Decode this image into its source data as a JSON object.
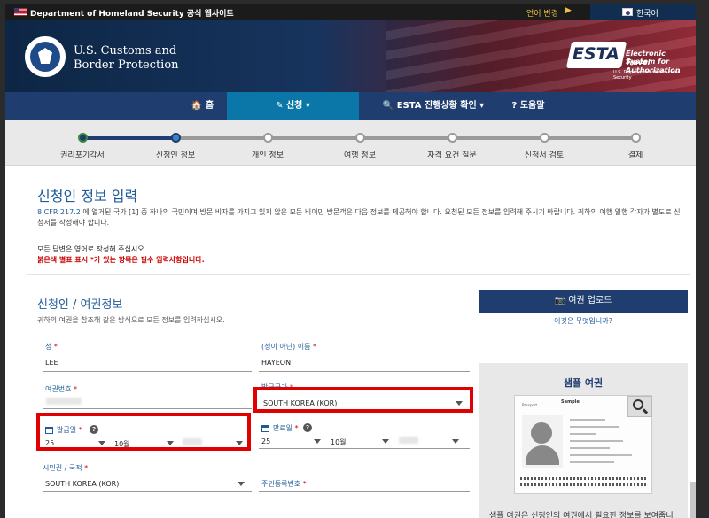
{
  "topbar": {
    "gov_text": "Department of Homeland Security 공식 웹사이트",
    "lang_change": "언어 변경",
    "lang_arrow": "▶",
    "current_lang": "한국어"
  },
  "header": {
    "agency_line1": "U.S. Customs and",
    "agency_line2": "Border Protection",
    "esta_logo": "ESTA",
    "esta_sub1": "Electronic System for",
    "esta_sub2": "Travel Authorization",
    "esta_sub3": "U.S. Department of Homeland Security"
  },
  "nav": {
    "home": "🏠 홈",
    "apply": "✎ 신청 ▾",
    "status": "🔍 ESTA 진행상황 확인 ▾",
    "help": "? 도움말"
  },
  "progress": {
    "steps": [
      "권리포기각서",
      "신청인 정보",
      "개인 정보",
      "여행 정보",
      "자격 요건 질문",
      "신청서 검토",
      "결제"
    ],
    "current_index": 1
  },
  "page": {
    "title": "신청인 정보 입력",
    "intro_cfr": "8 CFR 217.2",
    "intro_text": " 에 열거된 국가 [1] 중 하나의 국민이며 방문 비자를 가지고 있지 않은 모든 비이민 방문객은 다음 정보를 제공해야 합니다. 요청된 모든 정보를 입력해 주시기 바랍니다. 귀하의 여행 일행 각자가 별도로 신청서를 작성해야 합니다.",
    "note_english": "모든 답변은 영어로 작성해 주십시오.",
    "note_required": "붉은색 별표 표시 *가 있는 항목은 필수 입력사항입니다."
  },
  "section": {
    "title": "신청인 / 여권정보",
    "desc": "귀하의 여권을 참조해 같은 방식으로 모든 정보를 입력하십시오."
  },
  "form": {
    "surname_label": "성",
    "surname_value": "LEE",
    "given_label": "(성이 아닌) 이름",
    "given_value": "HAYEON",
    "passport_no_label": "여권번호",
    "issuing_country_label": "발급국가",
    "issuing_country_value": "SOUTH KOREA (KOR)",
    "issue_date_label": "발급일",
    "issue_day": "25",
    "issue_month": "10월",
    "expiry_date_label": "만료일",
    "expiry_day": "25",
    "expiry_month": "10월",
    "citizenship_label": "시민권 / 국적",
    "citizenship_value": "SOUTH KOREA (KOR)",
    "national_id_label": "주민등록번호",
    "required_mark": "*"
  },
  "sidebar": {
    "upload_button": "📷 여권 업로드",
    "what_is_this": "이것은 무엇입니까?",
    "sample_title": "샘플 여권",
    "sample_caption": "샘플 여권은 신청인의 여권에서 필요한 정보를 보여줍니",
    "pp_label": "Sample",
    "pp_type": "Passport"
  },
  "colors": {
    "accent": "#1f5b99",
    "nav": "#1f3d6e",
    "nav_active": "#0b77a8",
    "highlight": "#e00000",
    "required": "#cc0000"
  }
}
